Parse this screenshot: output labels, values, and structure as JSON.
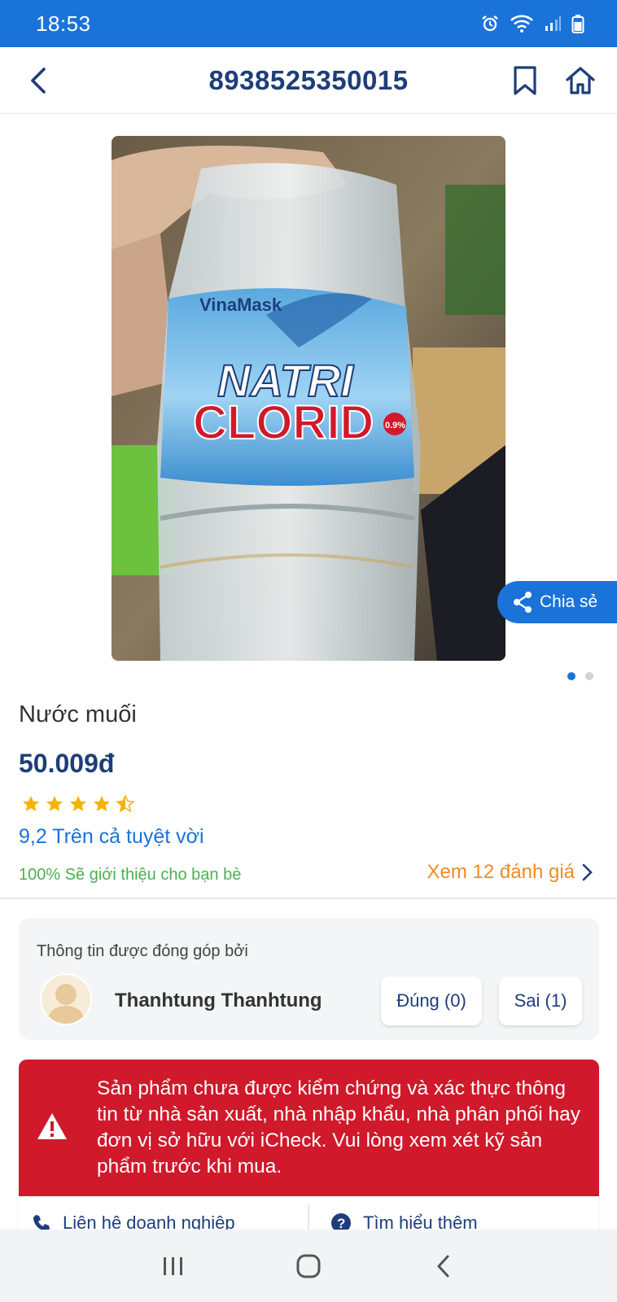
{
  "status_bar": {
    "time": "18:53"
  },
  "header": {
    "title": "8938525350015"
  },
  "share": {
    "label": "Chia sẻ"
  },
  "product": {
    "name": "Nước muối",
    "price": "50.009đ",
    "rating": 4.5,
    "rating_summary": "9,2 Trên cả tuyệt vời",
    "recommend": "100% Sẽ giới thiệu cho bạn bè",
    "reviews_link": "Xem 12 đánh giá",
    "image_labels": {
      "brand": "VinaMask",
      "line1": "NATRI",
      "line2": "CLORID",
      "badge": "0.9%"
    }
  },
  "contributor": {
    "label": "Thông tin được đóng góp bởi",
    "name": "Thanhtung Thanhtung",
    "correct_label": "Đúng (0)",
    "wrong_label": "Sai (1)"
  },
  "warning": {
    "text": "Sản phẩm chưa được kiểm chứng và xác thực thông tin từ nhà sản xuất, nhà nhập khẩu, nhà phân phối hay đơn vị sở hữu với iCheck. Vui lòng xem xét kỹ sản phẩm trước khi mua."
  },
  "actions": {
    "contact": "Liên hệ doanh nghiệp",
    "learn_more": "Tìm hiểu thêm"
  },
  "colors": {
    "primary": "#1a73d9",
    "title": "#1d3e7a",
    "warning": "#d0192b",
    "orange": "#f08a24",
    "green": "#4caf50",
    "star": "#f5b301"
  },
  "icons": [
    "back-icon",
    "bookmark-icon",
    "home-icon",
    "share-icon",
    "chevron-right-icon",
    "warning-icon",
    "phone-icon",
    "help-icon",
    "recents-icon",
    "home-nav-icon",
    "back-nav-icon"
  ]
}
